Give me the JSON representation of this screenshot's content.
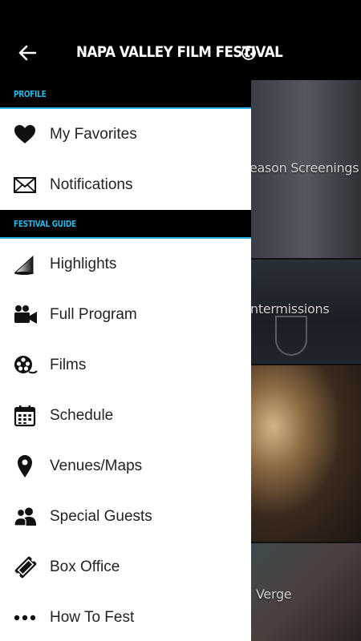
{
  "header": {
    "title": "NAPA VALLEY FILM FESTIVAL",
    "back_icon": "arrow-left-icon",
    "logo_icon": "film-reel-icon"
  },
  "drawer": {
    "profile_section": "PROFILE",
    "profile_items": [
      {
        "label": "My Favorites",
        "icon": "heart-icon"
      },
      {
        "label": "Notifications",
        "icon": "envelope-icon"
      }
    ],
    "guide_section": "FESTIVAL GUIDE",
    "guide_items": [
      {
        "label": "Highlights",
        "icon": "spotlight-icon"
      },
      {
        "label": "Full Program",
        "icon": "video-camera-icon"
      },
      {
        "label": "Films",
        "icon": "film-reel-icon"
      },
      {
        "label": "Schedule",
        "icon": "calendar-icon"
      },
      {
        "label": "Venues/Maps",
        "icon": "map-pin-icon"
      },
      {
        "label": "Special Guests",
        "icon": "people-icon"
      },
      {
        "label": "Box Office",
        "icon": "ticket-icon"
      },
      {
        "label": "How To Fest",
        "icon": "more-dots-icon"
      }
    ]
  },
  "background_tiles": [
    {
      "label": "eason Screenings"
    },
    {
      "label": "ntermissions"
    },
    {
      "label": ""
    },
    {
      "label": "Verge"
    }
  ],
  "colors": {
    "accent": "#29b6e8",
    "header_bg": "#000000",
    "drawer_bg": "#ffffff",
    "text": "#222222"
  }
}
